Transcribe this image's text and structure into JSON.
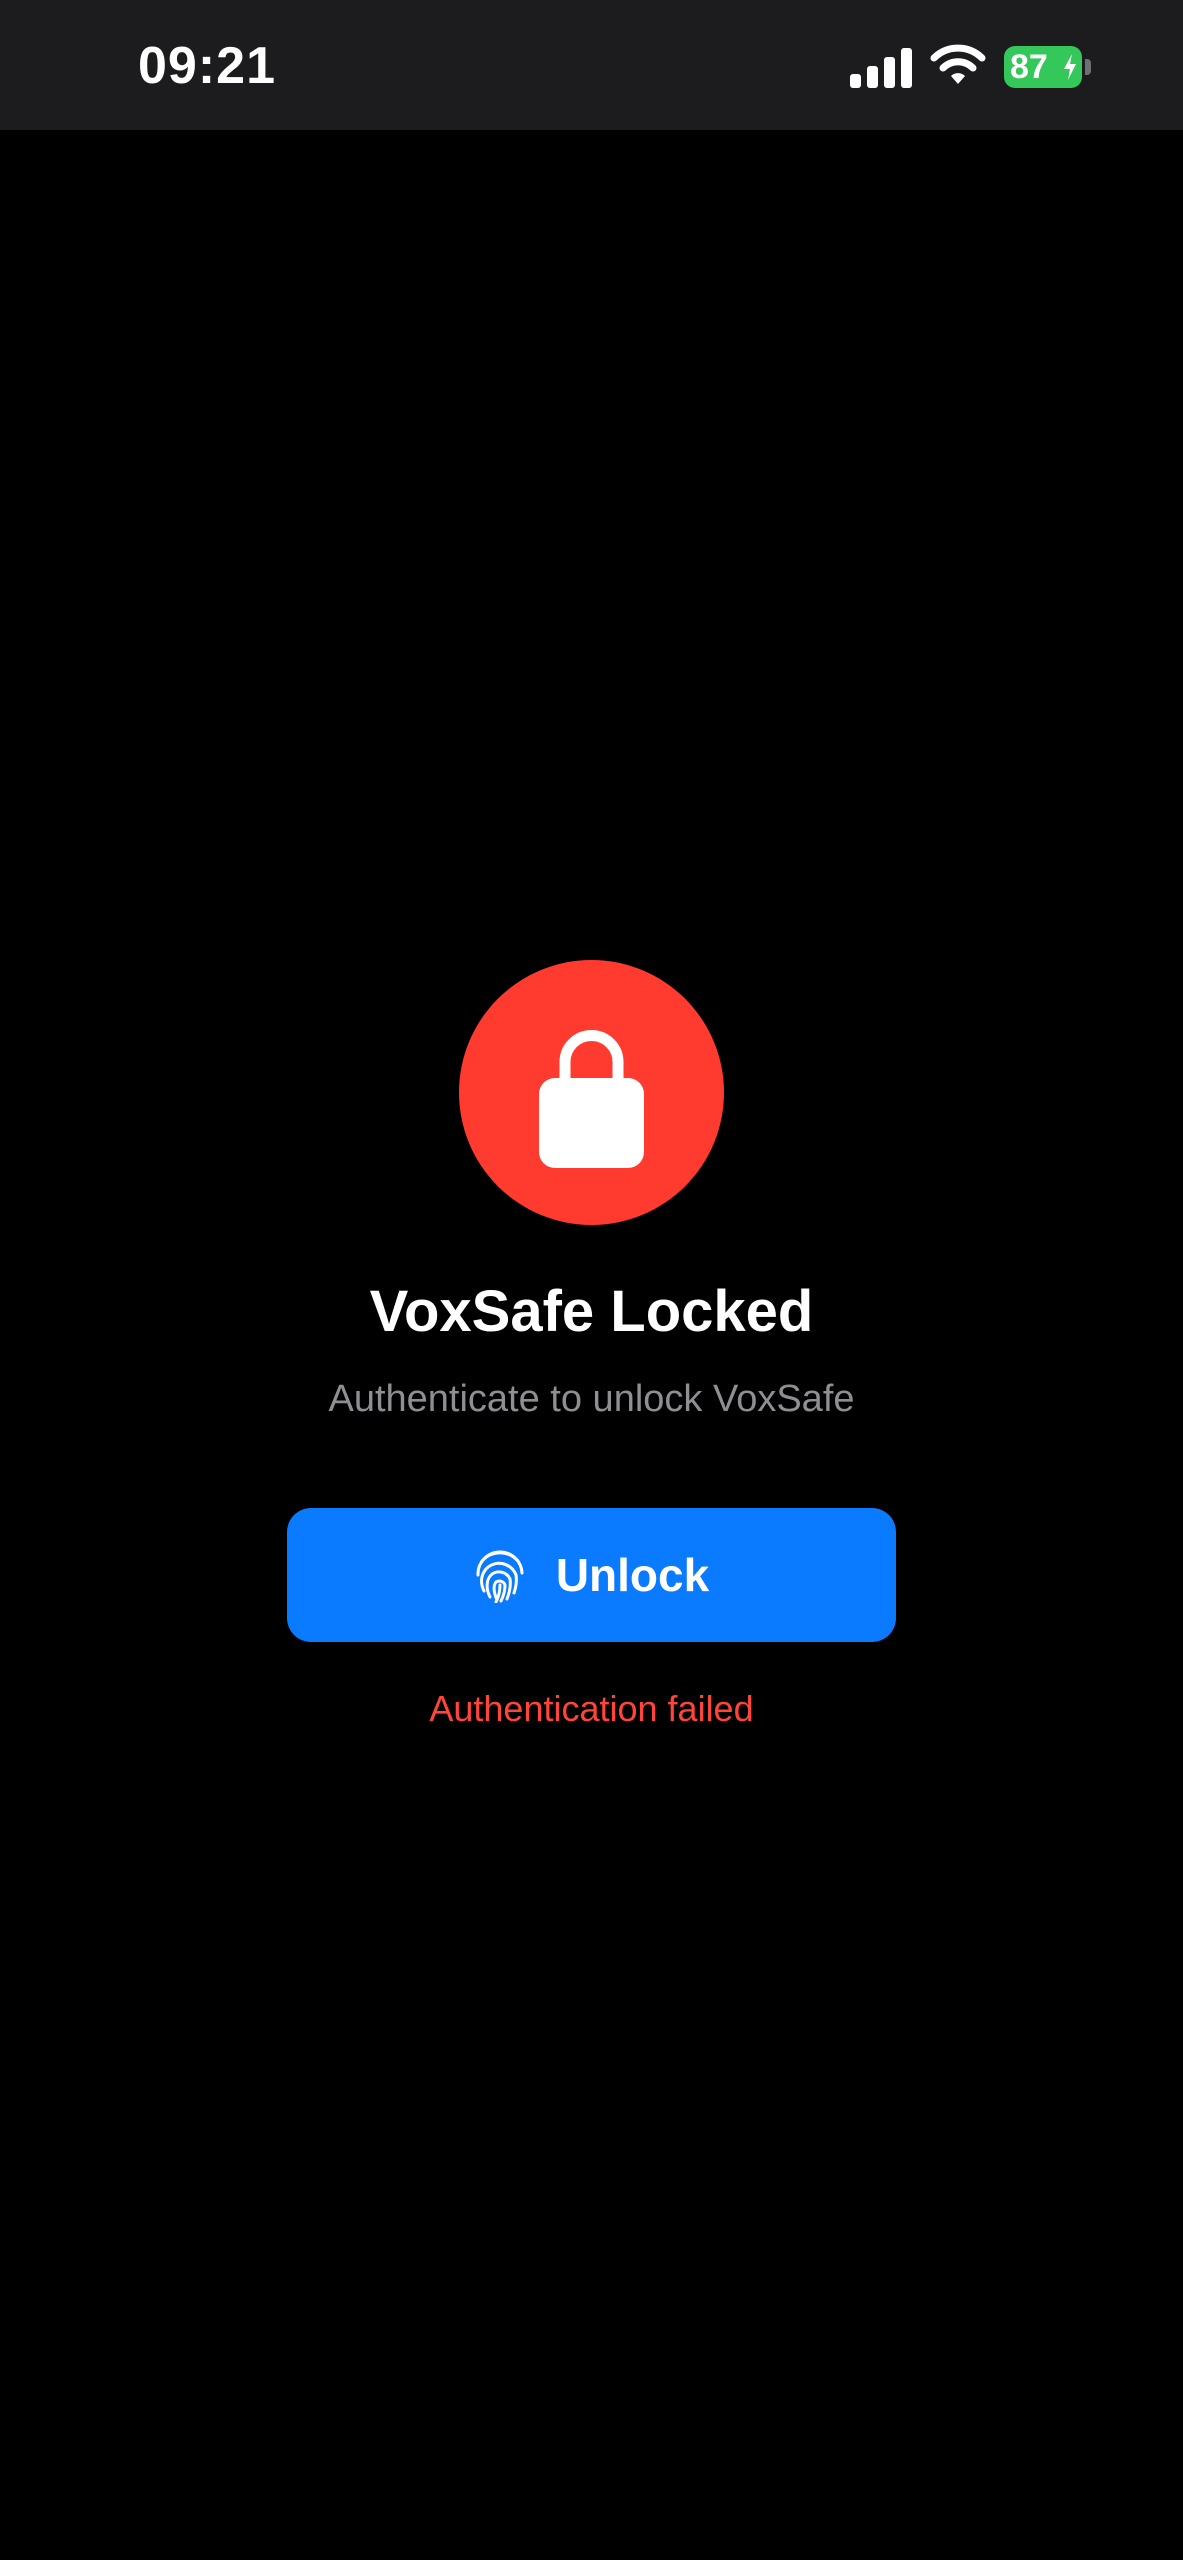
{
  "status_bar": {
    "time": "09:21",
    "battery_level": "87",
    "battery_color": "#34c759",
    "icons": [
      "signal-icon",
      "wifi-icon",
      "battery-icon",
      "charging-bolt-icon"
    ]
  },
  "lock_screen": {
    "icon": "lock-icon",
    "icon_background": "#ff3b30",
    "title": "VoxSafe Locked",
    "subtitle": "Authenticate to unlock VoxSafe",
    "unlock_button": {
      "label": "Unlock",
      "icon": "fingerprint-icon",
      "color": "#0a7aff"
    },
    "error_message": "Authentication failed",
    "error_color": "#ff453a"
  }
}
